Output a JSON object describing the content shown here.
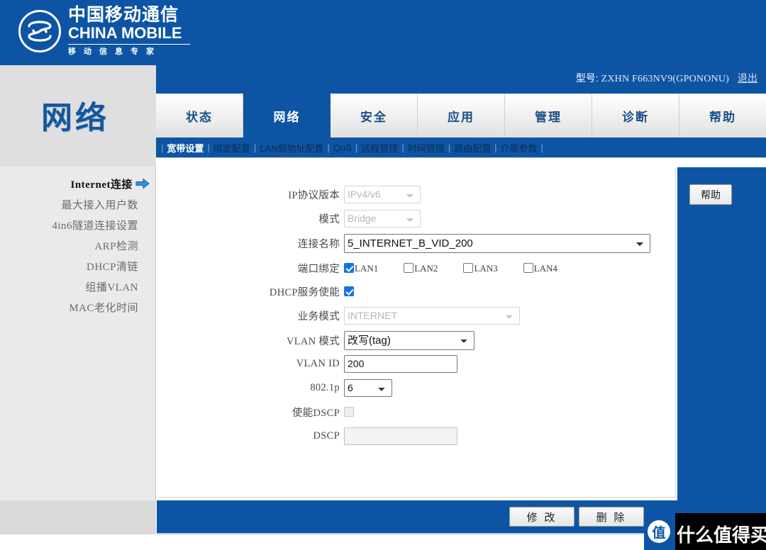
{
  "brand": {
    "name_cn": "中国移动通信",
    "name_en": "CHINA MOBILE",
    "slogan": "移动信息专家",
    "logo_icon": "china-mobile-logo-icon",
    "bar_color": "#0d55a4"
  },
  "header": {
    "model_label": "型号:",
    "model_value": "ZXHN F663NV9(GPONONU)",
    "logout_label": "退出"
  },
  "section": {
    "title": "网络"
  },
  "tabs": [
    {
      "label": "状态",
      "active": false
    },
    {
      "label": "网络",
      "active": true
    },
    {
      "label": "安全",
      "active": false
    },
    {
      "label": "应用",
      "active": false
    },
    {
      "label": "管理",
      "active": false
    },
    {
      "label": "诊断",
      "active": false
    },
    {
      "label": "帮助",
      "active": false
    }
  ],
  "subnav": [
    {
      "label": "宽带设置",
      "active": true
    },
    {
      "label": "绑定配置",
      "active": false
    },
    {
      "label": "LAN侧地址配置",
      "active": false
    },
    {
      "label": "QoS",
      "active": false
    },
    {
      "label": "远程管理",
      "active": false
    },
    {
      "label": "时间管理",
      "active": false
    },
    {
      "label": "路由配置",
      "active": false
    },
    {
      "label": "介质参数",
      "active": false
    }
  ],
  "sidebar": {
    "items": [
      {
        "label": "Internet连接",
        "active": true
      },
      {
        "label": "最大接入用户数",
        "active": false
      },
      {
        "label": "4in6隧道连接设置",
        "active": false
      },
      {
        "label": "ARP检测",
        "active": false
      },
      {
        "label": "DHCP清链",
        "active": false
      },
      {
        "label": "组播VLAN",
        "active": false
      },
      {
        "label": "MAC老化时间",
        "active": false
      }
    ]
  },
  "form": {
    "ip_version": {
      "label": "IP协议版本",
      "value": "IPv4/v6",
      "disabled": true
    },
    "mode": {
      "label": "模式",
      "value": "Bridge",
      "disabled": true
    },
    "conn_name": {
      "label": "连接名称",
      "value": "5_INTERNET_B_VID_200",
      "disabled": false
    },
    "port_bind": {
      "label": "端口绑定",
      "ports": [
        {
          "label": "LAN1",
          "checked": true
        },
        {
          "label": "LAN2",
          "checked": false
        },
        {
          "label": "LAN3",
          "checked": false
        },
        {
          "label": "LAN4",
          "checked": false
        }
      ]
    },
    "dhcp_enable": {
      "label": "DHCP服务使能",
      "checked": true
    },
    "service_mode": {
      "label": "业务模式",
      "value": "INTERNET",
      "disabled": true
    },
    "vlan_mode": {
      "label": "VLAN 模式",
      "value": "改写(tag)",
      "disabled": false
    },
    "vlan_id": {
      "label": "VLAN ID",
      "value": "200",
      "disabled": false
    },
    "p8021p": {
      "label": "802.1p",
      "value": "6",
      "disabled": false
    },
    "dscp_enable": {
      "label": "使能DSCP",
      "checked": false,
      "disabled": true
    },
    "dscp": {
      "label": "DSCP",
      "value": "",
      "disabled": true
    }
  },
  "help": {
    "button_label": "帮助"
  },
  "footer": {
    "modify_label": "修 改",
    "delete_label": "删 除"
  },
  "watermark": {
    "badge": "值",
    "text": "什么值得买"
  }
}
